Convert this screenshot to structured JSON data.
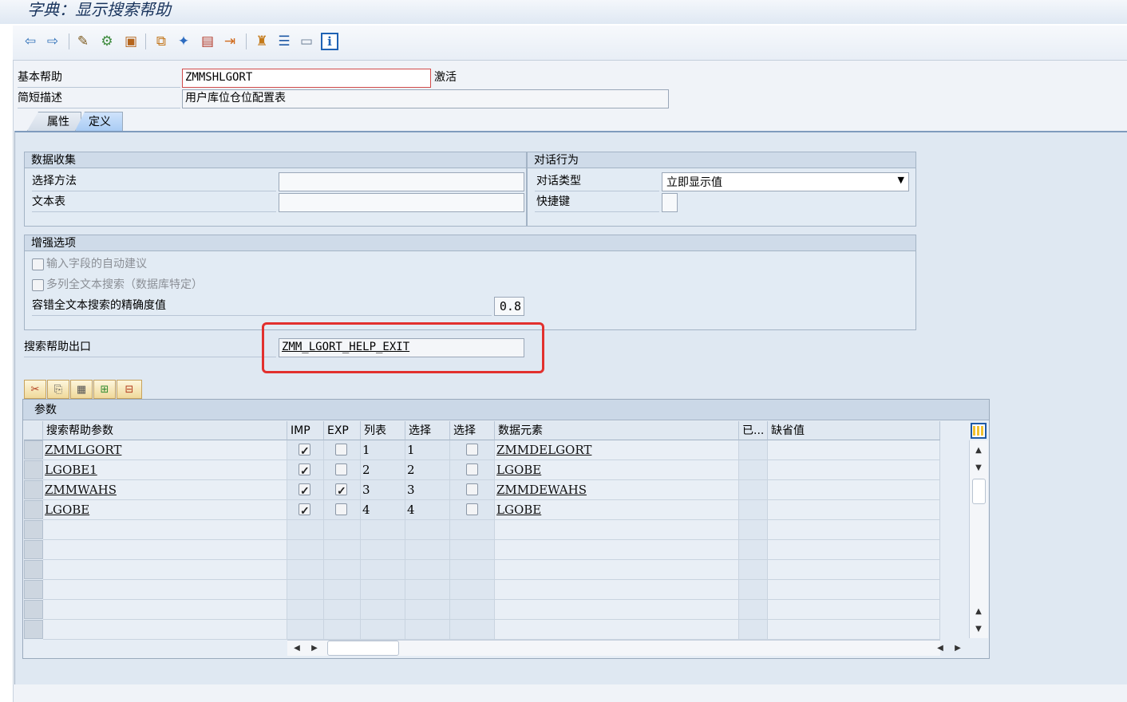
{
  "title": "字典：显示搜索帮助",
  "toolbar": {
    "icons": [
      "back-icon",
      "forward-icon",
      "display-change-icon",
      "other-object-icon",
      "activate-icon",
      "where-used-icon",
      "test-icon",
      "object-list-icon",
      "display-object-list-icon",
      "hierarchy-icon",
      "navigation-icon",
      "layout-icon",
      "info-icon"
    ]
  },
  "header": {
    "elementary_label": "基本帮助",
    "elementary_value": "ZMMSHLGORT",
    "status": "激活",
    "short_desc_label": "简短描述",
    "short_desc_value": "用户库位仓位配置表"
  },
  "tabs": [
    {
      "label": "属性",
      "active": false
    },
    {
      "label": "定义",
      "active": true
    }
  ],
  "data_collection": {
    "title": "数据收集",
    "selection_method_label": "选择方法",
    "selection_method_value": "",
    "text_table_label": "文本表",
    "text_table_value": ""
  },
  "dialog_behavior": {
    "title": "对话行为",
    "dialog_type_label": "对话类型",
    "dialog_type_value": "立即显示值",
    "hotkey_label": "快捷键",
    "hotkey_value": ""
  },
  "enhancement": {
    "title": "增强选项",
    "auto_suggest_label": "输入字段的自动建议",
    "multi_col_search_label": "多列全文本搜索（数据库特定）",
    "accuracy_label": "容错全文本搜索的精确度值",
    "accuracy_value": "0.8"
  },
  "exit": {
    "label": "搜索帮助出口",
    "value": "ZMM_LGORT_HELP_EXIT",
    "highlight_color": "#e2302e"
  },
  "params": {
    "title": "参数",
    "columns": [
      "搜索帮助参数",
      "IMP",
      "EXP",
      "列表",
      "选择",
      "选择",
      "数据元素",
      "已...",
      "缺省值"
    ],
    "rows": [
      {
        "param": "ZMMLGORT",
        "imp": true,
        "exp": false,
        "list": "1",
        "sel": "1",
        "sdis": false,
        "elem": "ZMMDELGORT"
      },
      {
        "param": "LGOBE1",
        "imp": true,
        "exp": false,
        "list": "2",
        "sel": "2",
        "sdis": false,
        "elem": "LGOBE"
      },
      {
        "param": "ZMMWAHS",
        "imp": true,
        "exp": true,
        "list": "3",
        "sel": "3",
        "sdis": false,
        "elem": "ZMMDEWAHS"
      },
      {
        "param": "LGOBE",
        "imp": true,
        "exp": false,
        "list": "4",
        "sel": "4",
        "sdis": false,
        "elem": "LGOBE"
      }
    ]
  }
}
